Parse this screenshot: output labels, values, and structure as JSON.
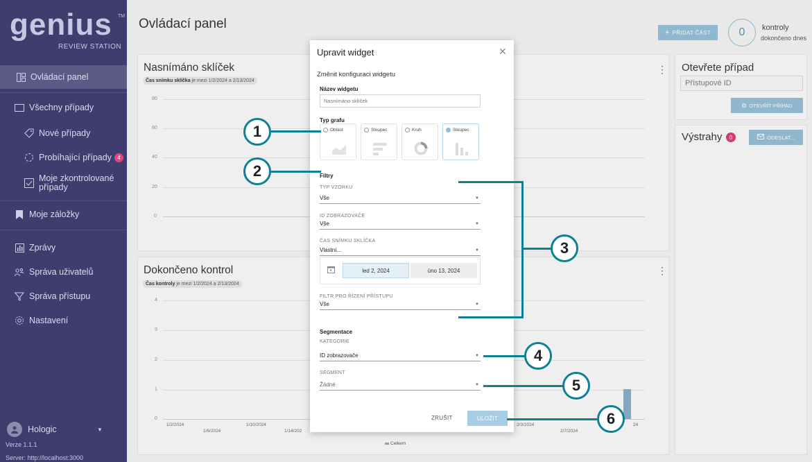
{
  "sidebar": {
    "logo_word": "genius",
    "logo_tm": "TM",
    "logo_sub": "REVIEW STATION",
    "items": [
      {
        "label": "Ovládací panel",
        "icon": "dashboard-icon"
      },
      {
        "label": "Všechny případy",
        "icon": "folder-icon"
      },
      {
        "label": "Nové případy",
        "icon": "tag-icon"
      },
      {
        "label": "Probíhající případy",
        "icon": "spinner-icon",
        "badge": "4"
      },
      {
        "label": "Moje zkontrolované případy",
        "icon": "checkbox-icon"
      },
      {
        "label": "Moje záložky",
        "icon": "bookmark-icon"
      },
      {
        "label": "Zprávy",
        "icon": "report-icon"
      },
      {
        "label": "Správa uživatelů",
        "icon": "users-icon"
      },
      {
        "label": "Správa přístupu",
        "icon": "access-icon"
      },
      {
        "label": "Nastavení",
        "icon": "gear-icon"
      }
    ],
    "user": "Hologic",
    "version": "Verze 1.1.1",
    "server": "Server: http://localhost:3000"
  },
  "header": {
    "title": "Ovládací panel",
    "add_button": "PŘIDAT ČÁST",
    "count": "0",
    "count_label1": "kontroly",
    "count_label2": "dokončeno dnes"
  },
  "card1": {
    "title": "Nasnímáno sklíček",
    "chip_bold": "Čas snímku sklíčka",
    "chip_rest": " je mezi 1/2/2024 a 2/13/2024",
    "yticks": [
      "80",
      "60",
      "40",
      "20",
      "0"
    ]
  },
  "card2": {
    "title": "Dokončeno kontrol",
    "chip_bold": "Čas kontroly",
    "chip_rest": " je mezi 1/2/2024 a 2/13/2024",
    "yticks": [
      "4",
      "3",
      "2",
      "1",
      "0"
    ],
    "xticks_top": [
      "1/2/2024",
      "1/10/2024",
      "2/3/2024"
    ],
    "xticks_bottom": [
      "1/6/2024",
      "1/14/202",
      "2/7/2024"
    ],
    "xtick_partial": "24",
    "legend": "Celkem"
  },
  "open_case": {
    "title": "Otevřete případ",
    "placeholder": "Přístupové ID",
    "button": "OTEVŘÍT PŘÍPAD"
  },
  "alerts": {
    "title": "Výstrahy",
    "badge": "0",
    "button": "ODESLAT..."
  },
  "modal": {
    "title": "Upravit widget",
    "subtitle": "Změnit konfiguraci widgetu",
    "name_label": "Název widgetu",
    "name_value": "Nasnímáno sklíček",
    "chart_type_label": "Typ grafu",
    "chart_options": [
      {
        "label": "Oblast",
        "selected": false
      },
      {
        "label": "Sloupec",
        "selected": false
      },
      {
        "label": "Kruh",
        "selected": false
      },
      {
        "label": "Sloupec",
        "selected": true
      }
    ],
    "filters_label": "Filtry",
    "sample_type_cap": "TYP VZORKU",
    "sample_type_value": "Vše",
    "viewer_id_cap": "ID ZOBRAZOVAČE",
    "viewer_id_value": "Vše",
    "slide_time_cap": "ČAS SNÍMKU SKLÍČKA",
    "slide_time_value": "Vlastní...",
    "date_from": "led 2, 2024",
    "date_to": "úno 13, 2024",
    "access_filter_cap": "FILTR PRO ŘÍZENÍ PŘÍSTUPU",
    "access_filter_value": "Vše",
    "segmentation_label": "Segmentace",
    "category_cap": "KATEGORIE",
    "category_value": "ID zobrazovače",
    "segment_cap": "SEGMENT",
    "segment_value": "Žádné",
    "cancel": "ZRUŠIT",
    "save": "ULOŽIT"
  },
  "callouts": [
    "1",
    "2",
    "3",
    "4",
    "5",
    "6"
  ],
  "colors": {
    "sidebar": "#3e3d6d",
    "accent": "#8fb8cf",
    "callout": "#0f7f96",
    "badge": "#e0457b"
  }
}
